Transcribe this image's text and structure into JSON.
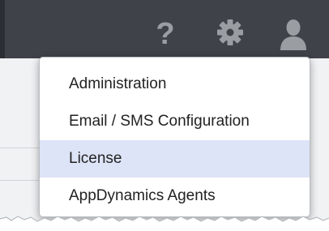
{
  "header": {
    "icons": {
      "help": "help-icon",
      "settings": "gear-icon",
      "account": "user-icon"
    },
    "background_color": "#3f4349",
    "icon_color": "#9a9da2"
  },
  "menu": {
    "items": [
      {
        "label": "Administration"
      },
      {
        "label": "Email / SMS Configuration"
      },
      {
        "label": "License",
        "selected": true
      },
      {
        "label": "AppDynamics Agents"
      }
    ],
    "highlight_color": "#dde4f7"
  }
}
